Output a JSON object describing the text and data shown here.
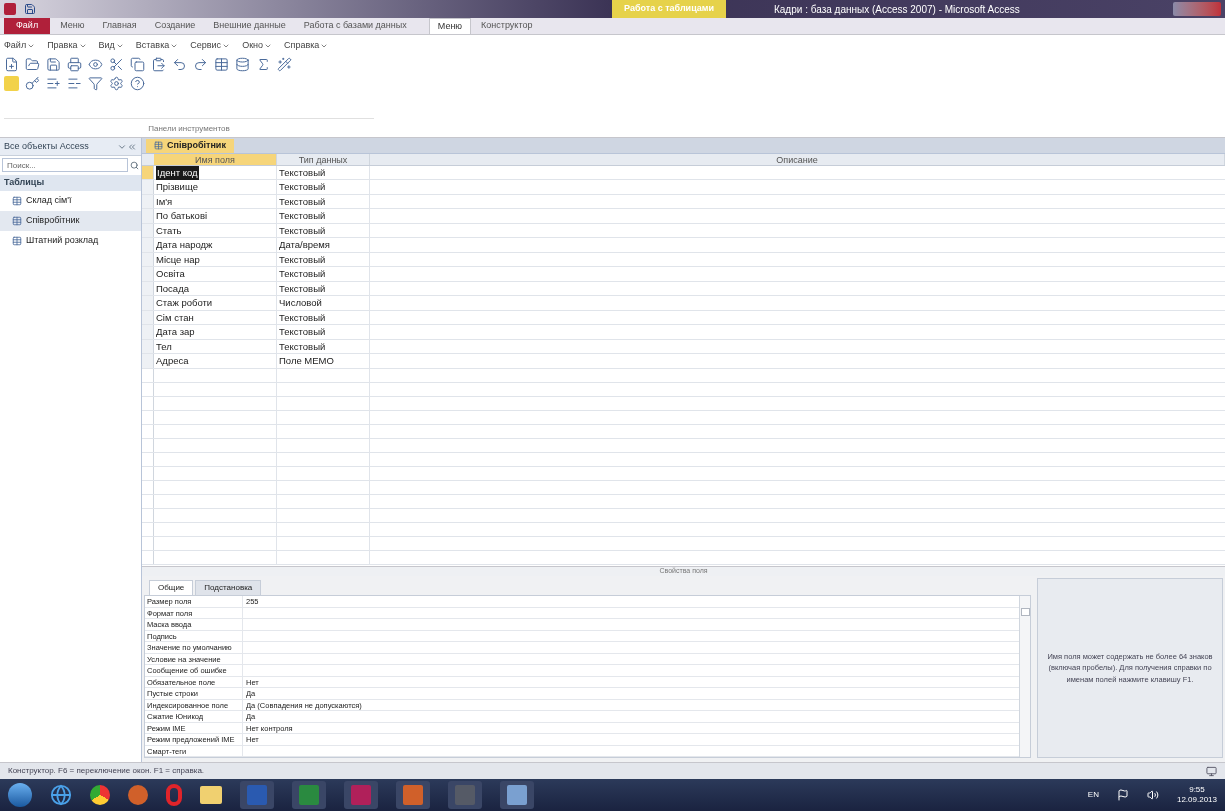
{
  "window": {
    "title": "Кадри : база данных (Access 2007) - Microsoft Access",
    "context_tab": "Работа с таблицами"
  },
  "ribbon_tabs": [
    {
      "label": "Файл",
      "kind": "file",
      "selected": false
    },
    {
      "label": "Меню",
      "kind": "tab",
      "selected": false
    },
    {
      "label": "Главная",
      "kind": "tab",
      "selected": false
    },
    {
      "label": "Создание",
      "kind": "tab",
      "selected": false
    },
    {
      "label": "Внешние данные",
      "kind": "tab",
      "selected": false
    },
    {
      "label": "Работа с базами данных",
      "kind": "tab",
      "selected": false
    },
    {
      "label": "Меню",
      "kind": "tab",
      "selected": true
    },
    {
      "label": "Конструктор",
      "kind": "tab",
      "selected": false
    }
  ],
  "menu": [
    "Файл",
    "Правка",
    "Вид",
    "Вставка",
    "Сервис",
    "Окно",
    "Справка"
  ],
  "toolbar_group": "Панели инструментов",
  "nav": {
    "title": "Все объекты Access",
    "search_placeholder": "Поиск...",
    "group": "Таблицы",
    "items": [
      {
        "label": "Склад сім'ї",
        "selected": false
      },
      {
        "label": "Співробітник",
        "selected": true
      },
      {
        "label": "Штатний розклад",
        "selected": false
      }
    ]
  },
  "document_tab": "Співробітник",
  "table": {
    "columns": [
      "Имя поля",
      "Тип данных",
      "Описание"
    ],
    "rows": [
      {
        "name": "Ідент код",
        "type": "Текстовый",
        "selected": true
      },
      {
        "name": "Прізвище",
        "type": "Текстовый",
        "selected": false
      },
      {
        "name": "Ім'я",
        "type": "Текстовый",
        "selected": false
      },
      {
        "name": "По батькові",
        "type": "Текстовый",
        "selected": false
      },
      {
        "name": "Стать",
        "type": "Текстовый",
        "selected": false
      },
      {
        "name": "Дата народж",
        "type": "Дата/время",
        "selected": false
      },
      {
        "name": "Місце нар",
        "type": "Текстовый",
        "selected": false
      },
      {
        "name": "Освіта",
        "type": "Текстовый",
        "selected": false
      },
      {
        "name": "Посада",
        "type": "Текстовый",
        "selected": false
      },
      {
        "name": "Стаж роботи",
        "type": "Числовой",
        "selected": false
      },
      {
        "name": "Сім стан",
        "type": "Текстовый",
        "selected": false
      },
      {
        "name": "Дата зар",
        "type": "Текстовый",
        "selected": false
      },
      {
        "name": "Тел",
        "type": "Текстовый",
        "selected": false
      },
      {
        "name": "Адреса",
        "type": "Поле MEMO",
        "selected": false
      }
    ]
  },
  "properties": {
    "title": "Свойства поля",
    "tabs": [
      {
        "label": "Общие",
        "selected": true
      },
      {
        "label": "Подстановка",
        "selected": false
      }
    ],
    "rows": [
      {
        "label": "Размер поля",
        "value": "255"
      },
      {
        "label": "Формат поля"
      },
      {
        "label": "Маска ввода"
      },
      {
        "label": "Подпись"
      },
      {
        "label": "Значение по умолчанию"
      },
      {
        "label": "Условие на значение"
      },
      {
        "label": "Сообщение об ошибке"
      },
      {
        "label": "Обязательное поле",
        "value": "Нет"
      },
      {
        "label": "Пустые строки",
        "value": "Да"
      },
      {
        "label": "Индексированное поле",
        "value": "Да (Совпадения не допускаются)"
      },
      {
        "label": "Сжатие Юникод",
        "value": "Да"
      },
      {
        "label": "Режим IME",
        "value": "Нет контроля"
      },
      {
        "label": "Режим предложений IME",
        "value": "Нет"
      },
      {
        "label": "Смарт-теги"
      }
    ],
    "help": "Имя поля может содержать не более 64 знаков (включая пробелы). Для получения справки по именам полей нажмите клавишу F1."
  },
  "status_bar": "Конструктор. F6 = переключение окон. F1 = справка.",
  "taskbar": {
    "language": "EN",
    "time": "9:55",
    "date": "12.09.2013"
  }
}
